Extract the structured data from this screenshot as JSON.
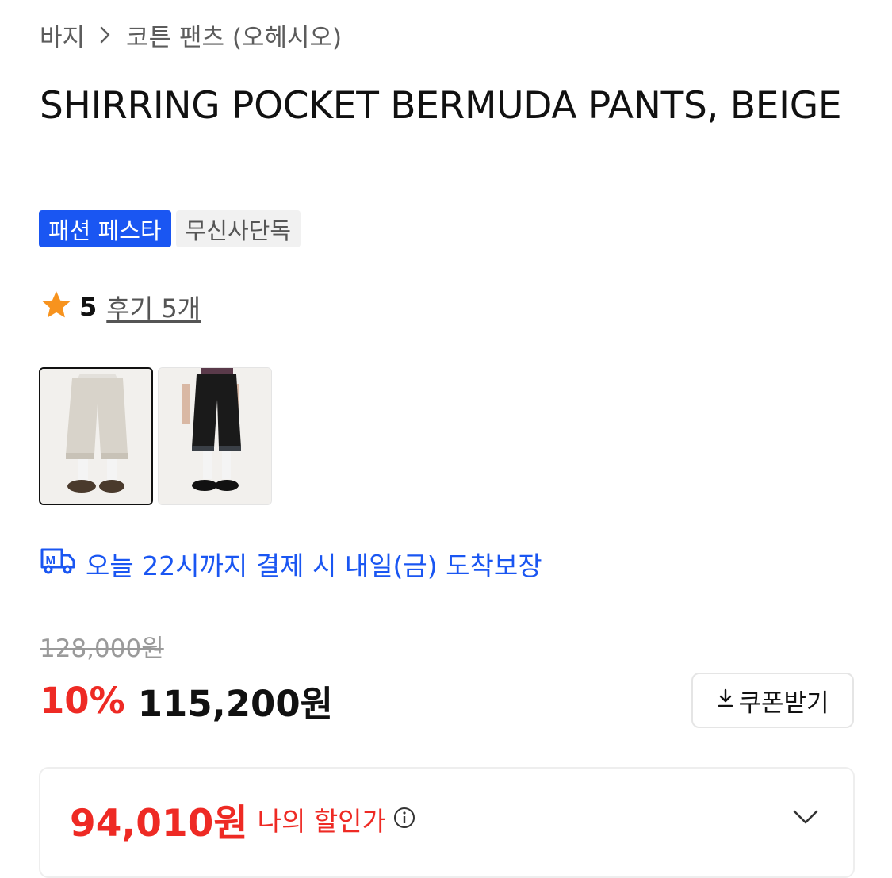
{
  "breadcrumb": {
    "items": [
      "바지",
      "코튼 팬츠 (오헤시오)"
    ]
  },
  "product": {
    "title": "SHIRRING POCKET BERMUDA PANTS, BEIGE"
  },
  "badges": [
    "패션 페스타",
    "무신사단독"
  ],
  "rating": {
    "score": "5",
    "review_link": "후기 5개"
  },
  "thumbnails": [
    {
      "label": "beige",
      "selected": true
    },
    {
      "label": "black",
      "selected": false
    }
  ],
  "delivery": {
    "text": "오늘 22시까지 결제 시 내일(금) 도착보장"
  },
  "price": {
    "original": "128,000원",
    "discount": "10%",
    "sale": "115,200원"
  },
  "coupon": {
    "label": "쿠폰받기"
  },
  "my_price": {
    "amount": "94,010원",
    "label": "나의 할인가"
  },
  "colors": {
    "brand_blue": "#1a56f2",
    "discount_red": "#ee2a24",
    "star": "#f7931e"
  }
}
